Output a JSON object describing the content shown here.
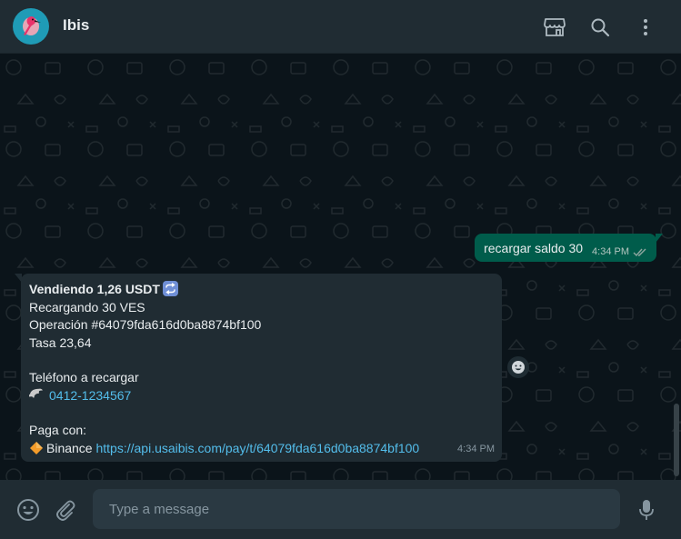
{
  "header": {
    "title": "Ibis",
    "icons": [
      "store-icon",
      "search-icon",
      "more-vertical-icon"
    ]
  },
  "messages": {
    "outgoing": {
      "text": "recargar saldo 30",
      "time": "4:34 PM",
      "status": "read"
    },
    "incoming": {
      "line1": "Vendiendo 1,26 USDT",
      "line2": "Recargando 30 VES",
      "line3": "Operación #64079fda616d0ba8874bf100",
      "line4": "Tasa 23,64",
      "phone_label": "Teléfono a recargar",
      "phone_number": "0412-1234567",
      "pay_label": "Paga con:",
      "pay_method": "Binance",
      "pay_link": "https://api.usaibis.com/pay/t/64079fda616d0ba8874bf100",
      "time": "4:34 PM"
    }
  },
  "composer": {
    "placeholder": "Type a message"
  },
  "colors": {
    "header_bg": "#202c33",
    "chat_bg": "#0b141a",
    "outgoing_bubble": "#005c4b",
    "incoming_bubble": "#202c33",
    "link": "#53bdeb"
  }
}
